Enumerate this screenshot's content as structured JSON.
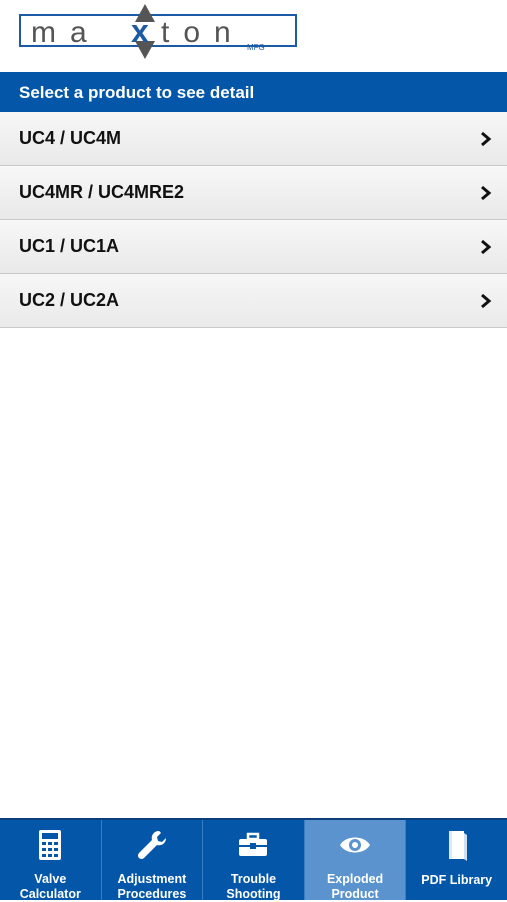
{
  "app": {
    "logo_text": "maxton",
    "logo_sub": "MFG"
  },
  "banner": {
    "title": "Select a product to see detail"
  },
  "products": [
    {
      "label": "UC4 / UC4M"
    },
    {
      "label": "UC4MR / UC4MRE2"
    },
    {
      "label": "UC1 / UC1A"
    },
    {
      "label": "UC2 / UC2A"
    }
  ],
  "tabs": [
    {
      "label": "Valve\nCalculator",
      "icon": "calculator-icon",
      "active": false
    },
    {
      "label": "Adjustment\nProcedures",
      "icon": "wrench-icon",
      "active": false
    },
    {
      "label": "Trouble\nShooting",
      "icon": "toolbox-icon",
      "active": false
    },
    {
      "label": "Exploded\nProduct",
      "icon": "eye-icon",
      "active": true
    },
    {
      "label": "PDF Library",
      "icon": "book-icon",
      "active": false
    }
  ],
  "colors": {
    "brand_blue": "#0356a8",
    "tab_active": "#5b93cf",
    "logo_gray": "#555555"
  }
}
